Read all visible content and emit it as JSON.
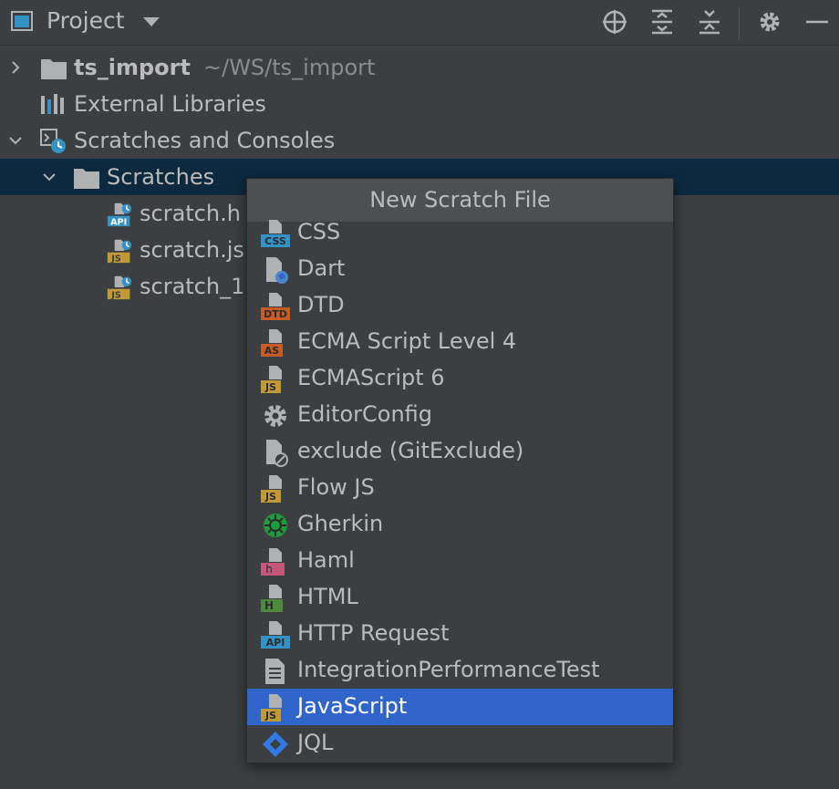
{
  "toolbar": {
    "title": "Project",
    "icons": [
      "project-view-icon",
      "locate-icon",
      "expand-all-icon",
      "collapse-all-icon",
      "settings-icon",
      "hide-icon"
    ]
  },
  "tree": {
    "root": {
      "name": "ts_import",
      "path": "~/WS/ts_import"
    },
    "external_libraries": "External Libraries",
    "scratches_and_consoles": "Scratches and Consoles",
    "scratches_folder": "Scratches",
    "files": [
      {
        "name": "scratch.h",
        "badge": "API"
      },
      {
        "name": "scratch.js",
        "badge": "JS"
      },
      {
        "name": "scratch_1",
        "badge": "JS"
      }
    ]
  },
  "popup": {
    "title": "New Scratch File",
    "items": [
      {
        "label": "CSS",
        "badge": "CSS",
        "badge_color": "#3592c4"
      },
      {
        "label": "Dart",
        "badge": "",
        "badge_color": "#4a86c8"
      },
      {
        "label": "DTD",
        "badge": "DTD",
        "badge_color": "#c75c23"
      },
      {
        "label": "ECMA Script Level 4",
        "badge": "AS",
        "badge_color": "#c75c23"
      },
      {
        "label": "ECMAScript 6",
        "badge": "JS",
        "badge_color": "#c19a35"
      },
      {
        "label": "EditorConfig",
        "badge": "",
        "badge_color": "#afb1b3"
      },
      {
        "label": "exclude (GitExclude)",
        "badge": "",
        "badge_color": "#afb1b3"
      },
      {
        "label": "Flow JS",
        "badge": "JS",
        "badge_color": "#c19a35"
      },
      {
        "label": "Gherkin",
        "badge": "",
        "badge_color": "#1f9a3c"
      },
      {
        "label": "Haml",
        "badge": "h",
        "badge_color": "#c4577a"
      },
      {
        "label": "HTML",
        "badge": "H",
        "badge_color": "#4e8a3b"
      },
      {
        "label": "HTTP Request",
        "badge": "API",
        "badge_color": "#3592c4"
      },
      {
        "label": "IntegrationPerformanceTest",
        "badge": "",
        "badge_color": "#afb1b3"
      },
      {
        "label": "JavaScript",
        "badge": "JS",
        "badge_color": "#c19a35",
        "selected": true
      },
      {
        "label": "JQL",
        "badge": "",
        "badge_color": "#2f7ae5"
      }
    ]
  },
  "colors": {
    "background": "#3c3f41",
    "selected_tree_row": "#0d293e",
    "selected_popup_item": "#2f65ca",
    "text": "#bbbbbb"
  }
}
